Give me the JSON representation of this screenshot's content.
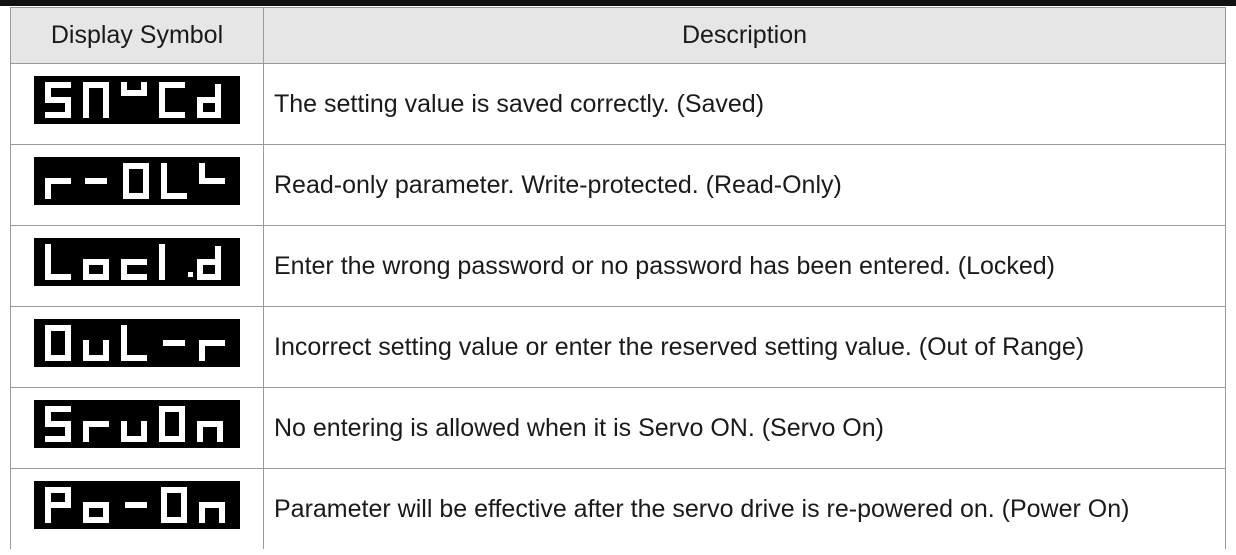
{
  "table": {
    "headers": [
      "Display Symbol",
      "Description"
    ],
    "rows": [
      {
        "symbol": "SAVEd",
        "description": "The setting value is saved correctly. (Saved)"
      },
      {
        "symbol": "r-0LY",
        "description": "Read-only parameter. Write-protected. (Read-Only)"
      },
      {
        "symbol": "LocK.d",
        "description": "Enter the wrong password or no password has been entered. (Locked)"
      },
      {
        "symbol": "Out-r",
        "description": "Incorrect setting value or enter the reserved setting value. (Out of Range)"
      },
      {
        "symbol": "SruOn",
        "description": "No entering is allowed when it is Servo ON. (Servo On)"
      },
      {
        "symbol": "Po-On",
        "description": "Parameter will be effective after the servo drive is re-powered on. (Power On)"
      }
    ]
  },
  "colors": {
    "display_bg": "#000000",
    "segment_on": "#ffffff",
    "header_bg": "#e6e6e6"
  }
}
